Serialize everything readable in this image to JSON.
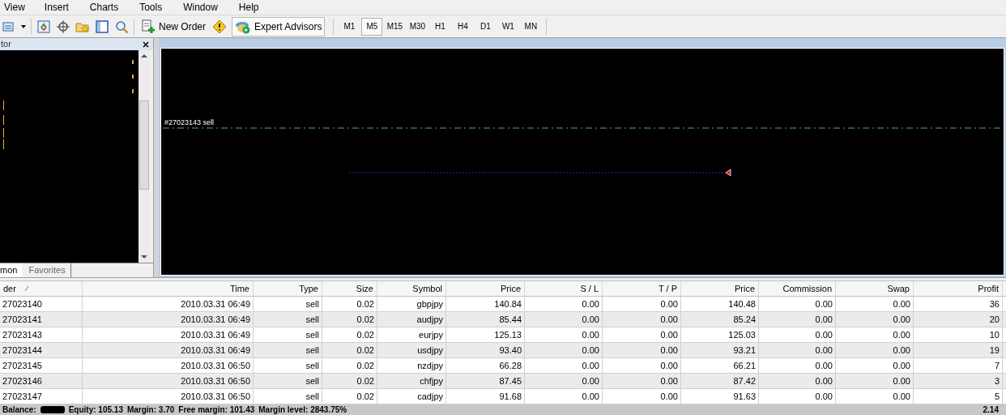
{
  "menu": [
    "View",
    "Insert",
    "Charts",
    "Tools",
    "Window",
    "Help"
  ],
  "toolbar": {
    "new_order": "New Order",
    "expert_advisors": {
      "label": "Expert Advisors",
      "on": true
    },
    "timeframes": [
      {
        "label": "M1",
        "selected": false
      },
      {
        "label": "M5",
        "selected": true
      },
      {
        "label": "M15",
        "selected": false
      },
      {
        "label": "M30",
        "selected": false
      },
      {
        "label": "H1",
        "selected": false
      },
      {
        "label": "H4",
        "selected": false
      },
      {
        "label": "D1",
        "selected": false
      },
      {
        "label": "W1",
        "selected": false
      },
      {
        "label": "MN",
        "selected": false
      }
    ]
  },
  "navigator": {
    "title": "tor",
    "tabs": [
      {
        "label": "mon",
        "selected": true
      },
      {
        "label": "Favorites",
        "selected": false
      }
    ]
  },
  "chart": {
    "order_label": "#27023143 sell"
  },
  "table": {
    "columns": [
      "der",
      "Time",
      "Type",
      "Size",
      "Symbol",
      "Price",
      "S / L",
      "T / P",
      "Price",
      "Commission",
      "Swap",
      "Profit"
    ],
    "rows": [
      [
        "27023140",
        "2010.03.31 06:49",
        "sell",
        "0.02",
        "gbpjpy",
        "140.84",
        "0.00",
        "0.00",
        "140.48",
        "0.00",
        "0.00",
        "36"
      ],
      [
        "27023141",
        "2010.03.31 06:49",
        "sell",
        "0.02",
        "audjpy",
        "85.44",
        "0.00",
        "0.00",
        "85.24",
        "0.00",
        "0.00",
        "20"
      ],
      [
        "27023143",
        "2010.03.31 06:49",
        "sell",
        "0.02",
        "eurjpy",
        "125.13",
        "0.00",
        "0.00",
        "125.03",
        "0.00",
        "0.00",
        "10"
      ],
      [
        "27023144",
        "2010.03.31 06:49",
        "sell",
        "0.02",
        "usdjpy",
        "93.40",
        "0.00",
        "0.00",
        "93.21",
        "0.00",
        "0.00",
        "19"
      ],
      [
        "27023145",
        "2010.03.31 06:50",
        "sell",
        "0.02",
        "nzdjpy",
        "66.28",
        "0.00",
        "0.00",
        "66.21",
        "0.00",
        "0.00",
        "7"
      ],
      [
        "27023146",
        "2010.03.31 06:50",
        "sell",
        "0.02",
        "chfjpy",
        "87.45",
        "0.00",
        "0.00",
        "87.42",
        "0.00",
        "0.00",
        "3"
      ],
      [
        "27023147",
        "2010.03.31 06:50",
        "sell",
        "0.02",
        "cadjpy",
        "91.68",
        "0.00",
        "0.00",
        "91.63",
        "0.00",
        "0.00",
        "5"
      ]
    ]
  },
  "status": {
    "balance": "Balance:",
    "equity": "Equity: 105.13",
    "margin": "Margin: 3.70",
    "free_margin": "Free margin: 101.43",
    "margin_level": "Margin level: 2843.75%",
    "total": "2.14"
  }
}
